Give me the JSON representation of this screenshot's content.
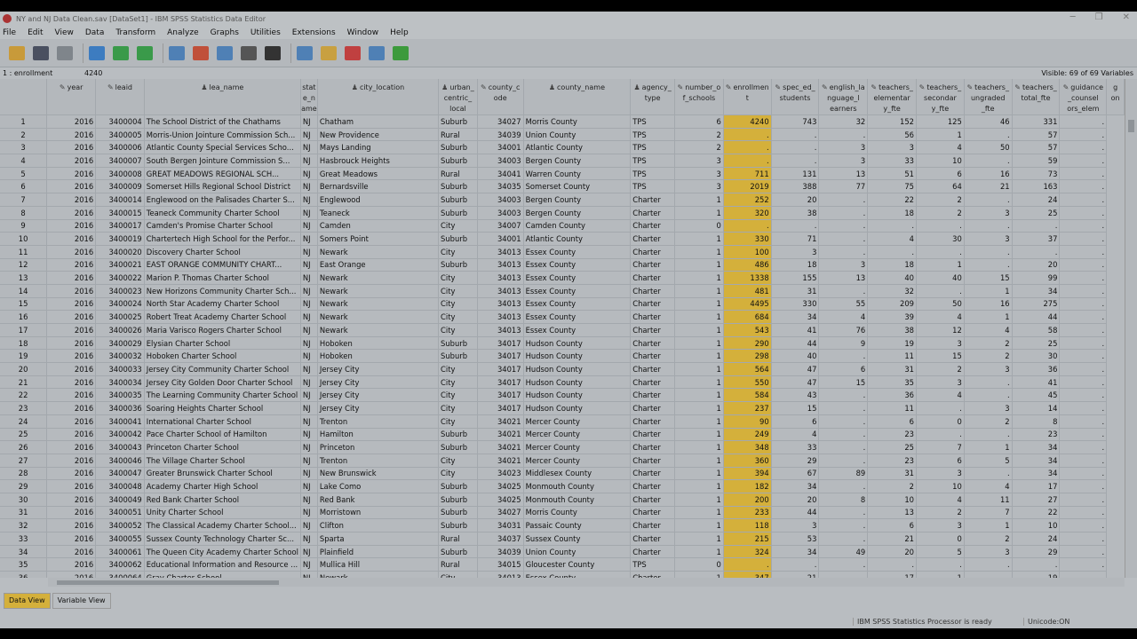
{
  "window": {
    "title": "NY and NJ Data Clean.sav [DataSet1] - IBM SPSS Statistics Data Editor",
    "controls": [
      "─",
      "❐",
      "✕"
    ]
  },
  "menu": [
    "File",
    "Edit",
    "View",
    "Data",
    "Transform",
    "Analyze",
    "Graphs",
    "Utilities",
    "Extensions",
    "Window",
    "Help"
  ],
  "toolbar": {
    "buttons": [
      {
        "name": "open-file-icon",
        "color": "#c89a3a"
      },
      {
        "name": "save-icon",
        "color": "#4a5060"
      },
      {
        "name": "print-icon",
        "color": "#7f858b"
      },
      {
        "name": "dialog-recall-icon",
        "color": "#3d7cc0"
      },
      {
        "name": "undo-icon",
        "color": "#3a9a4a"
      },
      {
        "name": "redo-icon",
        "color": "#3a9a4a"
      },
      {
        "name": "goto-case-icon",
        "color": "#4f80b5"
      },
      {
        "name": "goto-variable-icon",
        "color": "#c0503a"
      },
      {
        "name": "variables-icon",
        "color": "#4f80b5"
      },
      {
        "name": "find-icon",
        "color": "#555"
      },
      {
        "name": "binoculars-icon",
        "color": "#333"
      },
      {
        "name": "split-file-icon",
        "color": "#4f80b5"
      },
      {
        "name": "weight-cases-icon",
        "color": "#c8a040"
      },
      {
        "name": "select-cases-icon",
        "color": "#c04040"
      },
      {
        "name": "value-labels-icon",
        "color": "#4f80b5"
      },
      {
        "name": "use-sets-icon",
        "color": "#3c9a3c"
      }
    ]
  },
  "cellbar": {
    "ref": "1 : enrollment",
    "value": "4240",
    "visible": "Visible: 69 of 69 Variables"
  },
  "columns": [
    {
      "key": "year",
      "label": "year",
      "icon": "✎",
      "w": 56
    },
    {
      "key": "leaid",
      "label": "leaid",
      "icon": "✎",
      "w": 55
    },
    {
      "key": "lea_name",
      "label": "lea_name",
      "icon": "♟",
      "w": 162
    },
    {
      "key": "state",
      "label": "stat\ne_n\name",
      "icon": "",
      "w": 19
    },
    {
      "key": "city",
      "label": "city_location",
      "icon": "♟",
      "w": 138
    },
    {
      "key": "urban",
      "label": "urban_\ncentric_\nlocal",
      "icon": "♟",
      "w": 44
    },
    {
      "key": "county_code",
      "label": "county_c\node",
      "icon": "✎",
      "w": 52
    },
    {
      "key": "county_name",
      "label": "county_name",
      "icon": "♟",
      "w": 122
    },
    {
      "key": "agency",
      "label": "agency_\ntype",
      "icon": "♟",
      "w": 50
    },
    {
      "key": "nschools",
      "label": "number_o\nf_schools",
      "icon": "✎",
      "w": 55
    },
    {
      "key": "enroll",
      "label": "enrollmen\nt",
      "icon": "✎",
      "w": 54,
      "hl": true
    },
    {
      "key": "sped",
      "label": "spec_ed_\nstudents",
      "icon": "✎",
      "w": 54
    },
    {
      "key": "ell",
      "label": "english_la\nnguage_l\nearners",
      "icon": "✎",
      "w": 55
    },
    {
      "key": "t_elem",
      "label": "teachers_\nelementar\ny_fte",
      "icon": "✎",
      "w": 55
    },
    {
      "key": "t_sec",
      "label": "teachers_\nsecondar\ny_fte",
      "icon": "✎",
      "w": 54
    },
    {
      "key": "t_ung",
      "label": "teachers_\nungraded\n_fte",
      "icon": "✎",
      "w": 54
    },
    {
      "key": "t_tot",
      "label": "teachers_\ntotal_fte",
      "icon": "✎",
      "w": 54
    },
    {
      "key": "guid",
      "label": "guidance\n_counsel\nors_elem",
      "icon": "✎",
      "w": 53
    },
    {
      "key": "g2",
      "label": "g\non",
      "icon": "",
      "w": 20
    }
  ],
  "rows": [
    [
      "1",
      "2016",
      "3400004",
      "The School District of the Chathams",
      "NJ",
      "Chatham",
      "Suburb",
      "34027",
      "Morris County",
      "TPS",
      "6",
      "4240",
      "743",
      "32",
      "152",
      "125",
      "46",
      "331",
      "."
    ],
    [
      "2",
      "2016",
      "3400005",
      "Morris-Union Jointure Commission Sch...",
      "NJ",
      "New Providence",
      "Rural",
      "34039",
      "Union County",
      "TPS",
      "2",
      ".",
      ".",
      ".",
      "56",
      "1",
      ".",
      "57",
      "."
    ],
    [
      "3",
      "2016",
      "3400006",
      "Atlantic County Special Services Scho...",
      "NJ",
      "Mays Landing",
      "Suburb",
      "34001",
      "Atlantic County",
      "TPS",
      "2",
      ".",
      ".",
      "3",
      "3",
      "4",
      "50",
      "57",
      "."
    ],
    [
      "4",
      "2016",
      "3400007",
      "South  Bergen Jointure Commission S...",
      "NJ",
      "Hasbrouck Heights",
      "Suburb",
      "34003",
      "Bergen County",
      "TPS",
      "3",
      ".",
      ".",
      "3",
      "33",
      "10",
      ".",
      "59",
      "."
    ],
    [
      "5",
      "2016",
      "3400008",
      "GREAT MEADOWS REGIONAL SCH...",
      "NJ",
      "Great Meadows",
      "Rural",
      "34041",
      "Warren County",
      "TPS",
      "3",
      "711",
      "131",
      "13",
      "51",
      "6",
      "16",
      "73",
      "."
    ],
    [
      "6",
      "2016",
      "3400009",
      "Somerset Hills Regional School District",
      "NJ",
      "Bernardsville",
      "Suburb",
      "34035",
      "Somerset County",
      "TPS",
      "3",
      "2019",
      "388",
      "77",
      "75",
      "64",
      "21",
      "163",
      "."
    ],
    [
      "7",
      "2016",
      "3400014",
      "Englewood on the Palisades Charter S...",
      "NJ",
      "Englewood",
      "Suburb",
      "34003",
      "Bergen County",
      "Charter",
      "1",
      "252",
      "20",
      ".",
      "22",
      "2",
      ".",
      "24",
      "."
    ],
    [
      "8",
      "2016",
      "3400015",
      "Teaneck Community Charter School",
      "NJ",
      "Teaneck",
      "Suburb",
      "34003",
      "Bergen County",
      "Charter",
      "1",
      "320",
      "38",
      ".",
      "18",
      "2",
      "3",
      "25",
      "."
    ],
    [
      "9",
      "2016",
      "3400017",
      "Camden's Promise Charter School",
      "NJ",
      "Camden",
      "City",
      "34007",
      "Camden County",
      "Charter",
      "0",
      ".",
      ".",
      ".",
      ".",
      ".",
      ".",
      ".",
      "."
    ],
    [
      "10",
      "2016",
      "3400019",
      "Chartertech High School for the Perfor...",
      "NJ",
      "Somers Point",
      "Suburb",
      "34001",
      "Atlantic County",
      "Charter",
      "1",
      "330",
      "71",
      ".",
      "4",
      "30",
      "3",
      "37",
      "."
    ],
    [
      "11",
      "2016",
      "3400020",
      "Discovery Charter School",
      "NJ",
      "Newark",
      "City",
      "34013",
      "Essex County",
      "Charter",
      "1",
      "100",
      "3",
      ".",
      ".",
      ".",
      ".",
      ".",
      "."
    ],
    [
      "12",
      "2016",
      "3400021",
      "EAST ORANGE COMMUNITY CHART...",
      "NJ",
      "East Orange",
      "Suburb",
      "34013",
      "Essex County",
      "Charter",
      "1",
      "486",
      "18",
      "3",
      "18",
      "1",
      ".",
      "20",
      "."
    ],
    [
      "13",
      "2016",
      "3400022",
      "Marion P. Thomas Charter School",
      "NJ",
      "Newark",
      "City",
      "34013",
      "Essex County",
      "Charter",
      "1",
      "1338",
      "155",
      "13",
      "40",
      "40",
      "15",
      "99",
      "."
    ],
    [
      "14",
      "2016",
      "3400023",
      "New Horizons Community Charter Sch...",
      "NJ",
      "Newark",
      "City",
      "34013",
      "Essex County",
      "Charter",
      "1",
      "481",
      "31",
      ".",
      "32",
      ".",
      "1",
      "34",
      "."
    ],
    [
      "15",
      "2016",
      "3400024",
      "North Star Academy Charter School",
      "NJ",
      "Newark",
      "City",
      "34013",
      "Essex County",
      "Charter",
      "1",
      "4495",
      "330",
      "55",
      "209",
      "50",
      "16",
      "275",
      "."
    ],
    [
      "16",
      "2016",
      "3400025",
      "Robert Treat Academy Charter School",
      "NJ",
      "Newark",
      "City",
      "34013",
      "Essex County",
      "Charter",
      "1",
      "684",
      "34",
      "4",
      "39",
      "4",
      "1",
      "44",
      "."
    ],
    [
      "17",
      "2016",
      "3400026",
      "Maria Varisco Rogers Charter School",
      "NJ",
      "Newark",
      "City",
      "34013",
      "Essex County",
      "Charter",
      "1",
      "543",
      "41",
      "76",
      "38",
      "12",
      "4",
      "58",
      "."
    ],
    [
      "18",
      "2016",
      "3400029",
      "Elysian Charter School",
      "NJ",
      "Hoboken",
      "Suburb",
      "34017",
      "Hudson County",
      "Charter",
      "1",
      "290",
      "44",
      "9",
      "19",
      "3",
      "2",
      "25",
      "."
    ],
    [
      "19",
      "2016",
      "3400032",
      "Hoboken Charter School",
      "NJ",
      "Hoboken",
      "Suburb",
      "34017",
      "Hudson County",
      "Charter",
      "1",
      "298",
      "40",
      ".",
      "11",
      "15",
      "2",
      "30",
      "."
    ],
    [
      "20",
      "2016",
      "3400033",
      "Jersey City Community Charter School",
      "NJ",
      "Jersey City",
      "City",
      "34017",
      "Hudson County",
      "Charter",
      "1",
      "564",
      "47",
      "6",
      "31",
      "2",
      "3",
      "36",
      "."
    ],
    [
      "21",
      "2016",
      "3400034",
      "Jersey City Golden Door Charter School",
      "NJ",
      "Jersey City",
      "City",
      "34017",
      "Hudson County",
      "Charter",
      "1",
      "550",
      "47",
      "15",
      "35",
      "3",
      ".",
      "41",
      "."
    ],
    [
      "22",
      "2016",
      "3400035",
      "The Learning Community Charter School",
      "NJ",
      "Jersey City",
      "City",
      "34017",
      "Hudson County",
      "Charter",
      "1",
      "584",
      "43",
      ".",
      "36",
      "4",
      ".",
      "45",
      "."
    ],
    [
      "23",
      "2016",
      "3400036",
      "Soaring Heights Charter School",
      "NJ",
      "Jersey City",
      "City",
      "34017",
      "Hudson County",
      "Charter",
      "1",
      "237",
      "15",
      ".",
      "11",
      ".",
      "3",
      "14",
      "."
    ],
    [
      "24",
      "2016",
      "3400041",
      "International Charter School",
      "NJ",
      "Trenton",
      "City",
      "34021",
      "Mercer County",
      "Charter",
      "1",
      "90",
      "6",
      ".",
      "6",
      "0",
      "2",
      "8",
      "."
    ],
    [
      "25",
      "2016",
      "3400042",
      "Pace Charter School of Hamilton",
      "NJ",
      "Hamilton",
      "Suburb",
      "34021",
      "Mercer County",
      "Charter",
      "1",
      "249",
      "4",
      ".",
      "23",
      ".",
      ".",
      "23",
      "."
    ],
    [
      "26",
      "2016",
      "3400043",
      "Princeton Charter School",
      "NJ",
      "Princeton",
      "Suburb",
      "34021",
      "Mercer County",
      "Charter",
      "1",
      "348",
      "33",
      ".",
      "25",
      "7",
      "1",
      "34",
      "."
    ],
    [
      "27",
      "2016",
      "3400046",
      "The Village Charter School",
      "NJ",
      "Trenton",
      "City",
      "34021",
      "Mercer County",
      "Charter",
      "1",
      "360",
      "29",
      ".",
      "23",
      "6",
      "5",
      "34",
      "."
    ],
    [
      "28",
      "2016",
      "3400047",
      "Greater Brunswick Charter School",
      "NJ",
      "New Brunswick",
      "City",
      "34023",
      "Middlesex County",
      "Charter",
      "1",
      "394",
      "67",
      "89",
      "31",
      "3",
      ".",
      "34",
      "."
    ],
    [
      "29",
      "2016",
      "3400048",
      "Academy Charter High School",
      "NJ",
      "Lake Como",
      "Suburb",
      "34025",
      "Monmouth County",
      "Charter",
      "1",
      "182",
      "34",
      ".",
      "2",
      "10",
      "4",
      "17",
      "."
    ],
    [
      "30",
      "2016",
      "3400049",
      "Red Bank Charter School",
      "NJ",
      "Red Bank",
      "Suburb",
      "34025",
      "Monmouth County",
      "Charter",
      "1",
      "200",
      "20",
      "8",
      "10",
      "4",
      "11",
      "27",
      "."
    ],
    [
      "31",
      "2016",
      "3400051",
      "Unity Charter School",
      "NJ",
      "Morristown",
      "Suburb",
      "34027",
      "Morris County",
      "Charter",
      "1",
      "233",
      "44",
      ".",
      "13",
      "2",
      "7",
      "22",
      "."
    ],
    [
      "32",
      "2016",
      "3400052",
      "The Classical Academy Charter School...",
      "NJ",
      "Clifton",
      "Suburb",
      "34031",
      "Passaic County",
      "Charter",
      "1",
      "118",
      "3",
      ".",
      "6",
      "3",
      "1",
      "10",
      "."
    ],
    [
      "33",
      "2016",
      "3400055",
      "Sussex County Technology Charter Sc...",
      "NJ",
      "Sparta",
      "Rural",
      "34037",
      "Sussex County",
      "Charter",
      "1",
      "215",
      "53",
      ".",
      "21",
      "0",
      "2",
      "24",
      "."
    ],
    [
      "34",
      "2016",
      "3400061",
      "The Queen City Academy Charter School",
      "NJ",
      "Plainfield",
      "Suburb",
      "34039",
      "Union County",
      "Charter",
      "1",
      "324",
      "34",
      "49",
      "20",
      "5",
      "3",
      "29",
      "."
    ],
    [
      "35",
      "2016",
      "3400062",
      "Educational Information and Resource ...",
      "NJ",
      "Mullica Hill",
      "Rural",
      "34015",
      "Gloucester County",
      "TPS",
      "0",
      ".",
      ".",
      ".",
      ".",
      ".",
      ".",
      ".",
      "."
    ],
    [
      "36",
      "2016",
      "3400064",
      "Gray Charter School",
      "NJ",
      "Newark",
      "City",
      "34013",
      "Essex County",
      "Charter",
      "1",
      "347",
      "21",
      ".",
      "17",
      "1",
      ".",
      "19",
      "."
    ]
  ],
  "tabs": [
    "Data View",
    "Variable View"
  ],
  "status": {
    "processor": "IBM SPSS Statistics Processor is ready",
    "unicode": "Unicode:ON"
  },
  "colors": {
    "highlight": "#d4b03b"
  }
}
